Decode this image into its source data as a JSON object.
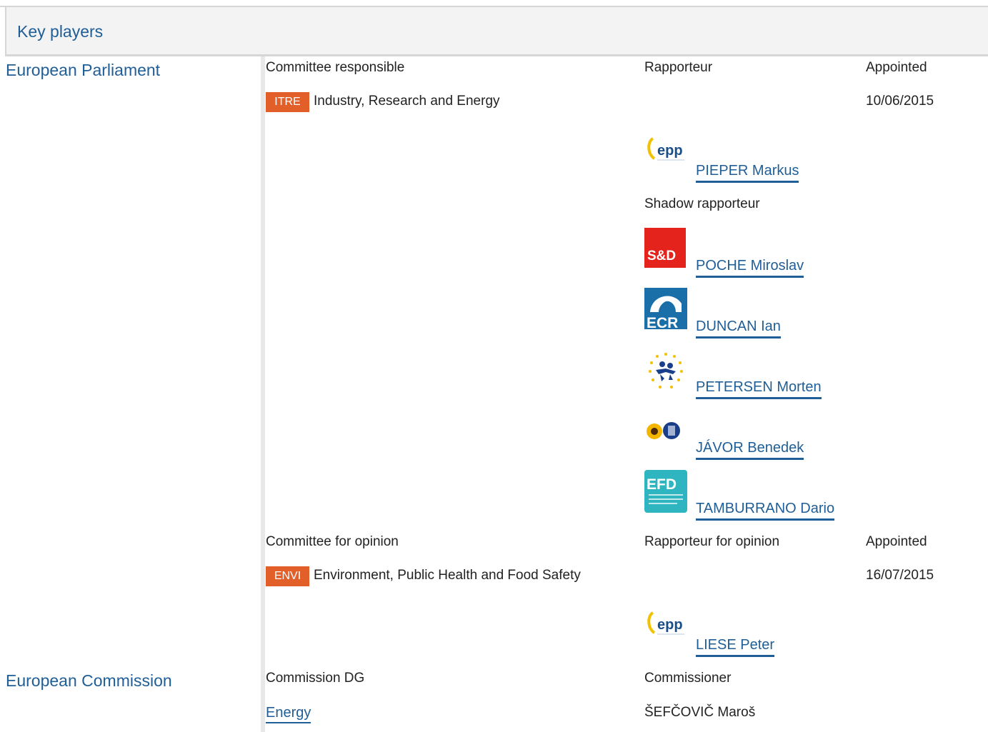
{
  "header": {
    "title": "Key players"
  },
  "parliament": {
    "label": "European Parliament",
    "responsible": {
      "col_committee": "Committee responsible",
      "col_rapporteur": "Rapporteur",
      "col_appointed": "Appointed",
      "badge": "ITRE",
      "committee_name": "Industry, Research and Energy",
      "appointed": "10/06/2015",
      "rapporteur": {
        "name": "PIEPER Markus",
        "group_icon": "epp-logo-icon"
      },
      "shadow_label": "Shadow rapporteur",
      "shadows": [
        {
          "name": "POCHE Miroslav",
          "group_icon": "sd-logo-icon",
          "logo_text": "S&D"
        },
        {
          "name": "DUNCAN Ian",
          "group_icon": "ecr-logo-icon",
          "logo_text": "ECR"
        },
        {
          "name": "PETERSEN Morten",
          "group_icon": "alde-logo-icon"
        },
        {
          "name": "JÁVOR Benedek",
          "group_icon": "greens-efa-logo-icon"
        },
        {
          "name": "TAMBURRANO Dario",
          "group_icon": "efdd-logo-icon",
          "logo_text": "EFD"
        }
      ]
    },
    "opinion": {
      "col_committee": "Committee for opinion",
      "col_rapporteur": "Rapporteur for opinion",
      "col_appointed": "Appointed",
      "badge": "ENVI",
      "committee_name": "Environment, Public Health and Food Safety",
      "appointed": "16/07/2015",
      "rapporteur": {
        "name": "LIESE Peter",
        "group_icon": "epp-logo-icon"
      }
    }
  },
  "commission": {
    "label": "European Commission",
    "col_dg": "Commission DG",
    "col_commissioner": "Commissioner",
    "dg": "Energy",
    "commissioner": "ŠEFČOVIČ Maroš"
  },
  "colors": {
    "accent": "#1f5e96",
    "badge": "#e35f2a",
    "sd_red": "#e3231c",
    "ecr_blue": "#1a6fa8",
    "efdd_teal": "#2fb5c0"
  }
}
